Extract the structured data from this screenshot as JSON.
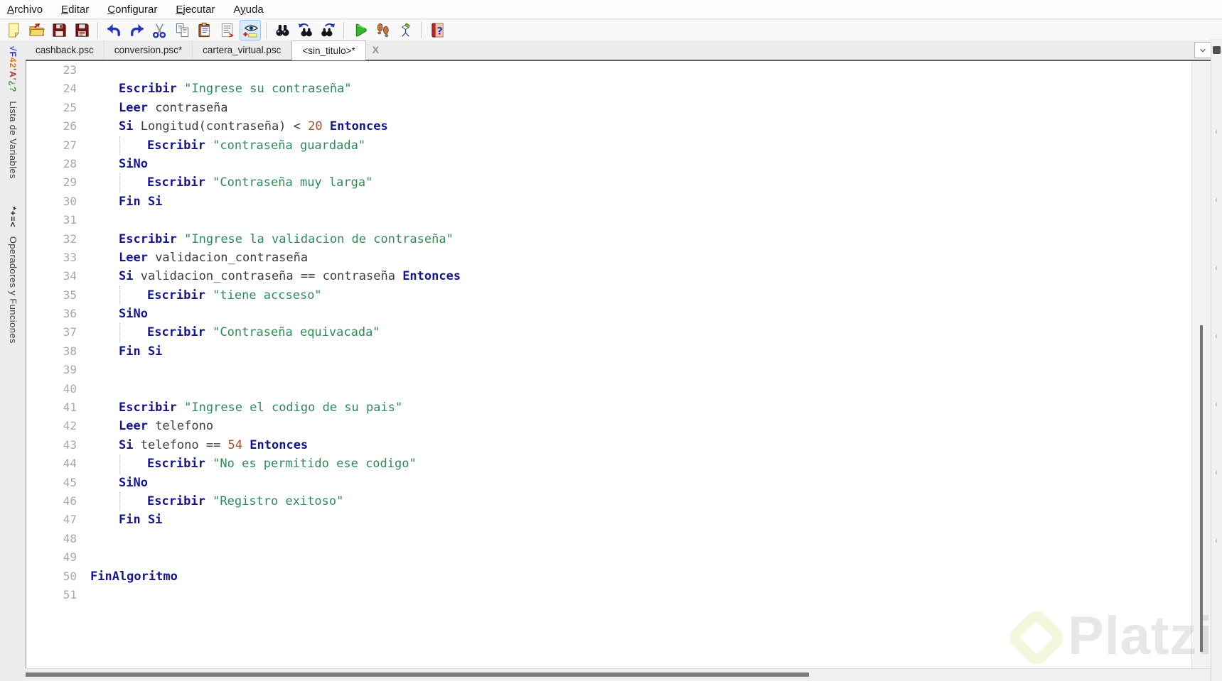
{
  "menu_bar": {
    "items": [
      {
        "label": "Archivo",
        "underline": 0
      },
      {
        "label": "Editar",
        "underline": 0
      },
      {
        "label": "Configurar",
        "underline": 0
      },
      {
        "label": "Ejecutar",
        "underline": 0
      },
      {
        "label": "Ayuda",
        "underline": 1
      }
    ]
  },
  "toolbar": {
    "buttons": [
      {
        "name": "new-file"
      },
      {
        "name": "open-file"
      },
      {
        "name": "save"
      },
      {
        "name": "save-all"
      },
      {
        "name": "sep"
      },
      {
        "name": "undo"
      },
      {
        "name": "redo"
      },
      {
        "name": "cut"
      },
      {
        "name": "copy"
      },
      {
        "name": "paste"
      },
      {
        "name": "auto-indent"
      },
      {
        "name": "syntax-check",
        "active": true
      },
      {
        "name": "sep"
      },
      {
        "name": "find"
      },
      {
        "name": "find-prev"
      },
      {
        "name": "find-next"
      },
      {
        "name": "sep"
      },
      {
        "name": "run"
      },
      {
        "name": "step-run"
      },
      {
        "name": "draw-flowchart"
      },
      {
        "name": "sep"
      },
      {
        "name": "help"
      }
    ]
  },
  "tab_bar": {
    "tabs": [
      {
        "label": "cashback.psc",
        "active": false
      },
      {
        "label": "conversion.psc*",
        "active": false
      },
      {
        "label": "cartera_virtual.psc",
        "active": false
      },
      {
        "label": "<sin_titulo>*",
        "active": true
      }
    ],
    "close_label": "X"
  },
  "side_panel": {
    "tabs": [
      {
        "id": "variables",
        "icon_parts": [
          {
            "text": "√F",
            "color": "#2929c8"
          },
          {
            "text": "42",
            "color": "#e07818"
          },
          {
            "text": "'A'",
            "color": "#b03030"
          },
          {
            "text": "¿?",
            "color": "#2f9e2f"
          }
        ],
        "label": "Lista de Variables"
      },
      {
        "id": "operadores",
        "icon_parts": [
          {
            "text": "*+=<",
            "color": "#222222"
          }
        ],
        "label": "Operadores y Funciones"
      }
    ]
  },
  "syntax_colors": {
    "keyword": "#15158c",
    "string": "#2e8b57",
    "number": "#a0522d",
    "identifier": "#3d3d3d",
    "line_number": "#a8a8a8"
  },
  "right_strip": {
    "handle_glyph": "‹",
    "handle_count": 7
  },
  "watermark": {
    "text": "Platzi",
    "logo_color": "#b6cf2e"
  },
  "editor": {
    "lines": [
      {
        "n": "23",
        "indent": 1,
        "tokens": []
      },
      {
        "n": "24",
        "indent": 1,
        "tokens": [
          [
            "k",
            "Escribir"
          ],
          [
            "i",
            " "
          ],
          [
            "s",
            "\"Ingrese su contraseña\""
          ]
        ]
      },
      {
        "n": "25",
        "indent": 1,
        "tokens": [
          [
            "k",
            "Leer"
          ],
          [
            "i",
            " contraseña"
          ]
        ]
      },
      {
        "n": "26",
        "indent": 1,
        "tokens": [
          [
            "k",
            "Si"
          ],
          [
            "i",
            " Longitud(contraseña) < "
          ],
          [
            "n",
            "20"
          ],
          [
            "i",
            " "
          ],
          [
            "k",
            "Entonces"
          ]
        ]
      },
      {
        "n": "27",
        "indent": 2,
        "guide": true,
        "tokens": [
          [
            "k",
            "Escribir"
          ],
          [
            "i",
            " "
          ],
          [
            "s",
            "\"contraseña guardada\""
          ]
        ]
      },
      {
        "n": "28",
        "indent": 1,
        "tokens": [
          [
            "k",
            "SiNo"
          ]
        ]
      },
      {
        "n": "29",
        "indent": 2,
        "guide": true,
        "tokens": [
          [
            "k",
            "Escribir"
          ],
          [
            "i",
            " "
          ],
          [
            "s",
            "\"Contraseña muy larga\""
          ]
        ]
      },
      {
        "n": "30",
        "indent": 1,
        "tokens": [
          [
            "k",
            "Fin Si"
          ]
        ]
      },
      {
        "n": "31",
        "indent": 1,
        "tokens": []
      },
      {
        "n": "32",
        "indent": 1,
        "tokens": [
          [
            "k",
            "Escribir"
          ],
          [
            "i",
            " "
          ],
          [
            "s",
            "\"Ingrese la validacion de contraseña\""
          ]
        ]
      },
      {
        "n": "33",
        "indent": 1,
        "tokens": [
          [
            "k",
            "Leer"
          ],
          [
            "i",
            " validacion_contraseña"
          ]
        ]
      },
      {
        "n": "34",
        "indent": 1,
        "tokens": [
          [
            "k",
            "Si"
          ],
          [
            "i",
            " validacion_contraseña == contraseña "
          ],
          [
            "k",
            "Entonces"
          ]
        ]
      },
      {
        "n": "35",
        "indent": 2,
        "guide": true,
        "tokens": [
          [
            "k",
            "Escribir"
          ],
          [
            "i",
            " "
          ],
          [
            "s",
            "\"tiene accseso\""
          ]
        ]
      },
      {
        "n": "36",
        "indent": 1,
        "tokens": [
          [
            "k",
            "SiNo"
          ]
        ]
      },
      {
        "n": "37",
        "indent": 2,
        "guide": true,
        "tokens": [
          [
            "k",
            "Escribir"
          ],
          [
            "i",
            " "
          ],
          [
            "s",
            "\"Contraseña equivacada\""
          ]
        ]
      },
      {
        "n": "38",
        "indent": 1,
        "tokens": [
          [
            "k",
            "Fin Si"
          ]
        ]
      },
      {
        "n": "39",
        "indent": 1,
        "tokens": []
      },
      {
        "n": "40",
        "indent": 1,
        "tokens": []
      },
      {
        "n": "41",
        "indent": 1,
        "tokens": [
          [
            "k",
            "Escribir"
          ],
          [
            "i",
            " "
          ],
          [
            "s",
            "\"Ingrese el codigo de su pais\""
          ]
        ]
      },
      {
        "n": "42",
        "indent": 1,
        "tokens": [
          [
            "k",
            "Leer"
          ],
          [
            "i",
            " telefono"
          ]
        ]
      },
      {
        "n": "43",
        "indent": 1,
        "tokens": [
          [
            "k",
            "Si"
          ],
          [
            "i",
            " telefono == "
          ],
          [
            "n",
            "54"
          ],
          [
            "i",
            " "
          ],
          [
            "k",
            "Entonces"
          ]
        ]
      },
      {
        "n": "44",
        "indent": 2,
        "guide": true,
        "tokens": [
          [
            "k",
            "Escribir"
          ],
          [
            "i",
            " "
          ],
          [
            "s",
            "\"No es permitido ese codigo\""
          ]
        ]
      },
      {
        "n": "45",
        "indent": 1,
        "tokens": [
          [
            "k",
            "SiNo"
          ]
        ]
      },
      {
        "n": "46",
        "indent": 2,
        "guide": true,
        "tokens": [
          [
            "k",
            "Escribir"
          ],
          [
            "i",
            " "
          ],
          [
            "s",
            "\"Registro exitoso\""
          ]
        ]
      },
      {
        "n": "47",
        "indent": 1,
        "tokens": [
          [
            "k",
            "Fin Si"
          ]
        ]
      },
      {
        "n": "48",
        "indent": 1,
        "tokens": []
      },
      {
        "n": "49",
        "indent": 1,
        "tokens": []
      },
      {
        "n": "50",
        "indent": 0,
        "tokens": [
          [
            "k",
            "FinAlgoritmo"
          ]
        ]
      },
      {
        "n": "51",
        "indent": 1,
        "tokens": []
      }
    ]
  }
}
